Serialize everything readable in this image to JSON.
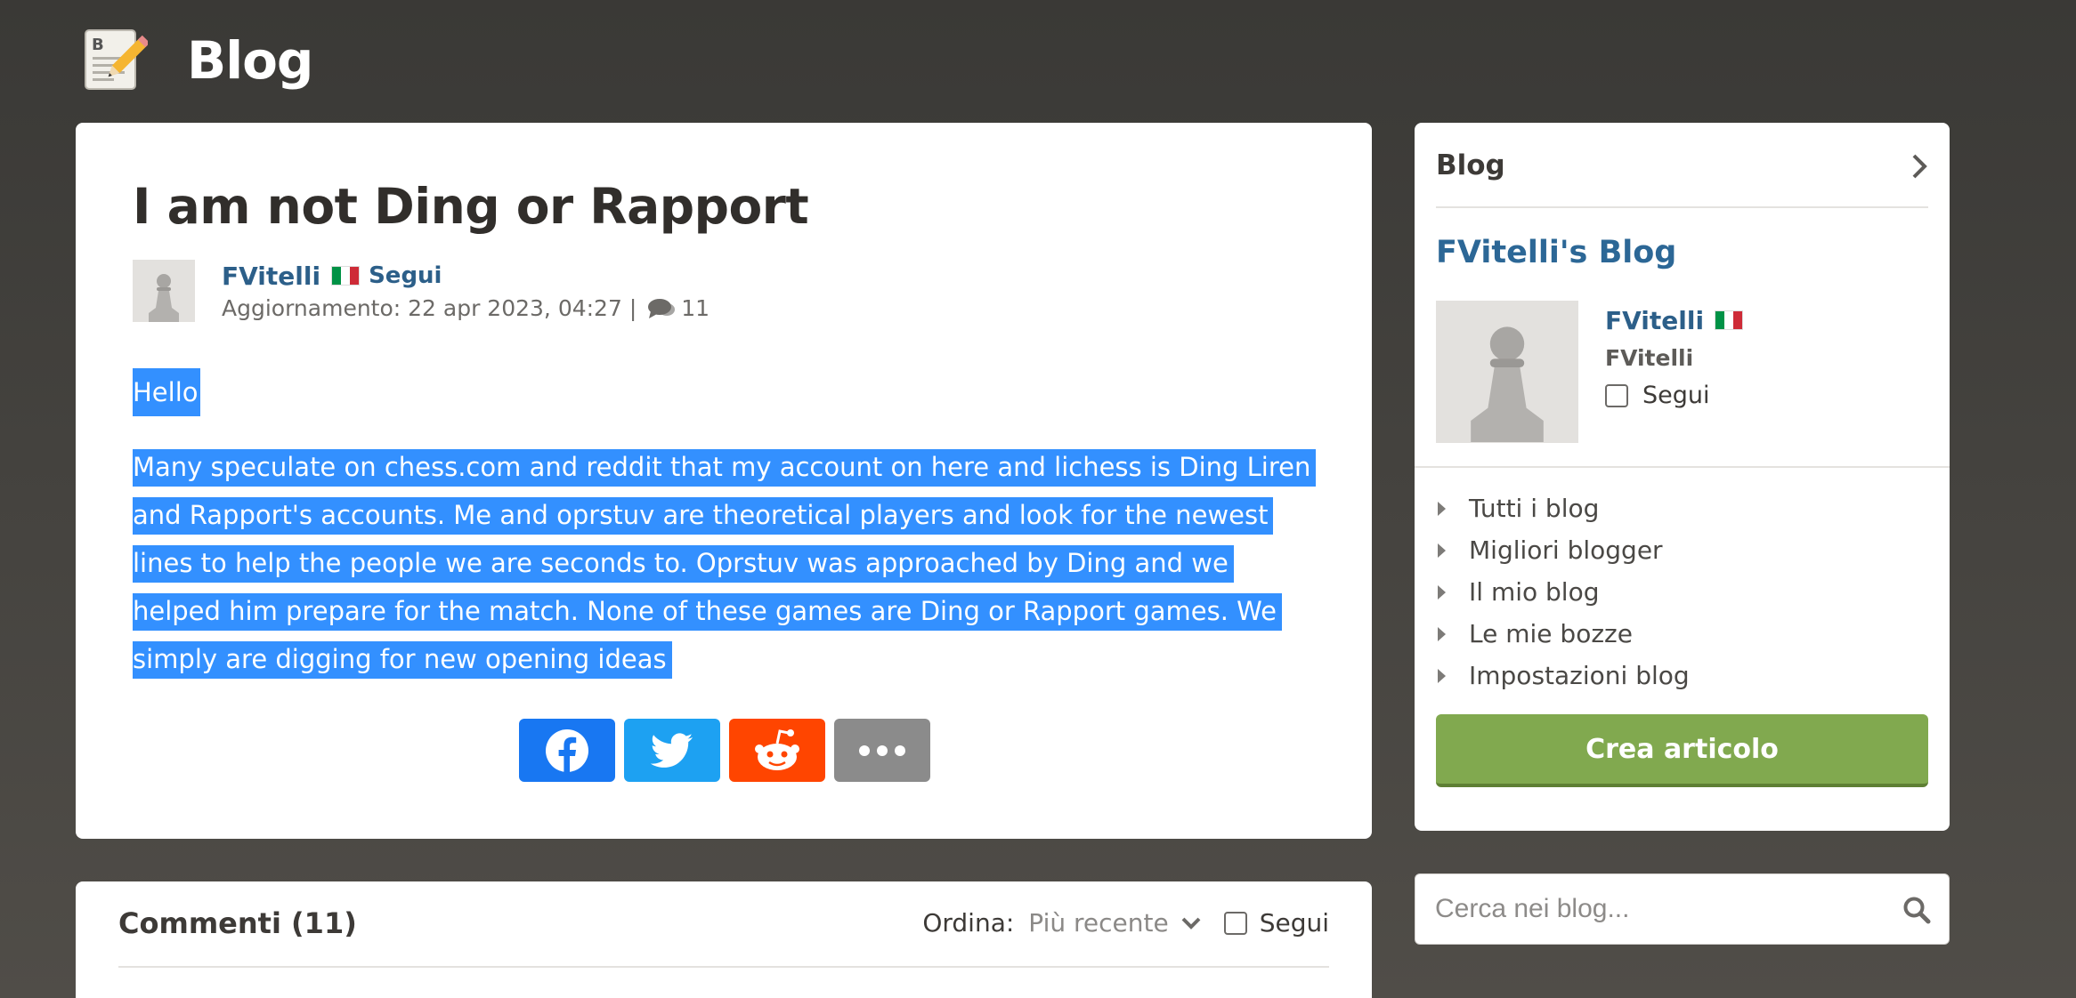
{
  "header": {
    "title": "Blog"
  },
  "article": {
    "title": "I am not Ding or Rapport",
    "author": "FVitelli",
    "follow_label": "Segui",
    "updated_label": "Aggiornamento: 22 apr 2023, 04:27 |",
    "comment_count": "11",
    "hello": "Hello",
    "body": "Many speculate on chess.com and reddit that my account on here and lichess is Ding Liren and Rapport's accounts. Me and oprstuv are theoretical players and look for the newest lines to help the people we are seconds to. Oprstuv was approached by Ding and we helped him prepare for the match. None of these games are Ding or Rapport games. We simply are digging for new opening ideas",
    "share_buttons": [
      "facebook-icon",
      "twitter-icon",
      "reddit-icon",
      "more-icon"
    ]
  },
  "comments": {
    "title": "Commenti (11)",
    "sort_label": "Ordina:",
    "sort_value": "Più recente",
    "follow_label": "Segui"
  },
  "sidebar": {
    "heading": "Blog",
    "blog_title": "FVitelli's Blog",
    "author": "FVitelli",
    "username": "FVitelli",
    "follow_label": "Segui",
    "links": [
      "Tutti i blog",
      "Migliori blogger",
      "Il mio blog",
      "Le mie bozze",
      "Impostazioni blog"
    ],
    "create_button": "Crea articolo"
  },
  "search": {
    "placeholder": "Cerca nei blog..."
  },
  "colors": {
    "link": "#2c5f89",
    "selection": "#3390ff",
    "create_button": "#81a94f",
    "facebook": "#1877f2",
    "twitter": "#1da1f2",
    "reddit": "#ff4500",
    "flag": [
      "#009246",
      "#ffffff",
      "#ce2b37"
    ]
  }
}
